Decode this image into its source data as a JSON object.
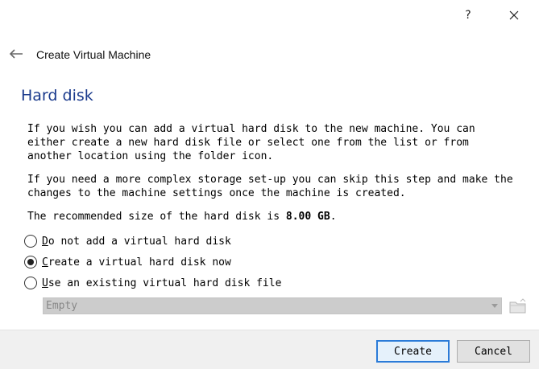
{
  "titlebar": {
    "help_label": "?",
    "close_icon": "close-icon"
  },
  "header": {
    "back_icon": "back-arrow-icon",
    "title": "Create Virtual Machine"
  },
  "page": {
    "title": "Hard disk",
    "para1": "If you wish you can add a virtual hard disk to the new machine. You can\neither create a new hard disk file or select one from the list or from\nanother location using the folder icon.",
    "para2": "If you need a more complex storage set-up you can skip this step and make the\nchanges to the machine settings once the machine is created.",
    "recommended_prefix": "The recommended size of the hard disk is ",
    "recommended_size": "8.00 GB",
    "recommended_suffix": "."
  },
  "options": {
    "no_disk": {
      "mnemonic": "D",
      "rest": "o not add a virtual hard disk",
      "checked": false
    },
    "create_disk": {
      "mnemonic": "C",
      "rest": "reate a virtual hard disk now",
      "checked": true
    },
    "use_existing": {
      "mnemonic": "U",
      "rest": "se an existing virtual hard disk file",
      "checked": false
    }
  },
  "existing_disk_select": {
    "value": "Empty",
    "enabled": false
  },
  "footer": {
    "create_label": "Create",
    "cancel_label": "Cancel"
  },
  "colors": {
    "title_blue": "#1a3a8c",
    "default_button_border": "#2b7bd8",
    "footer_bg": "#f0f0f0"
  }
}
